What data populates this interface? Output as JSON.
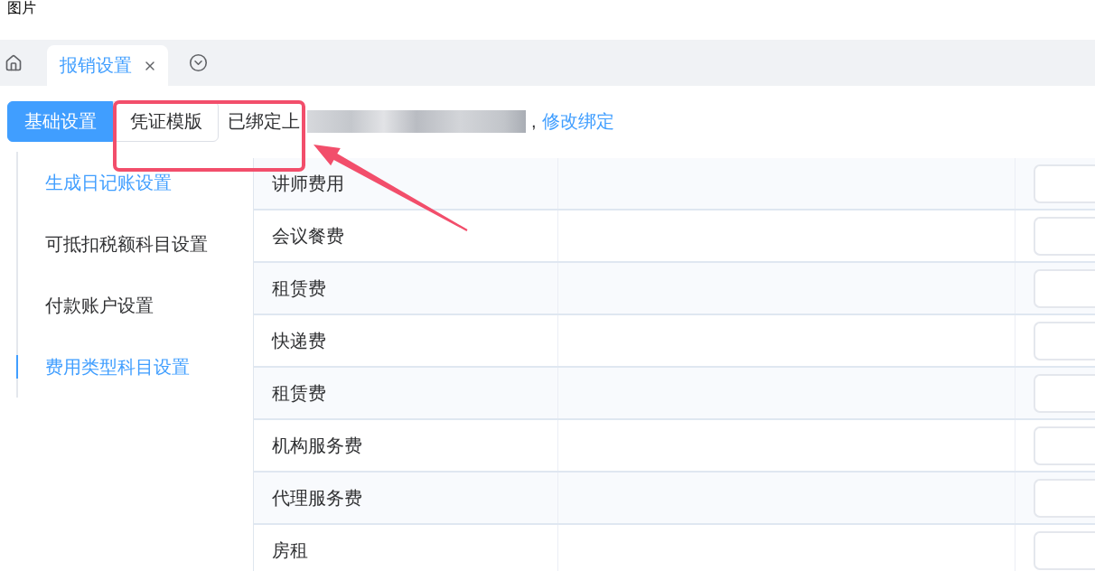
{
  "caption": "图片",
  "tabs": [
    {
      "label": "报销设置",
      "selected": true,
      "closable": true
    }
  ],
  "segments": [
    {
      "label": "基础设置",
      "selected": true
    },
    {
      "label": "凭证模版",
      "selected": false
    }
  ],
  "binding": {
    "status": "已绑定上",
    "separator": ",",
    "link": "修改绑定"
  },
  "menu": [
    {
      "label": "生成日记账设置",
      "selected": false,
      "hovered": true
    },
    {
      "label": "可抵扣税额科目设置",
      "selected": false,
      "hovered": false
    },
    {
      "label": "付款账户设置",
      "selected": false,
      "hovered": false
    },
    {
      "label": "费用类型科目设置",
      "selected": true,
      "hovered": false
    }
  ],
  "table": {
    "rows": [
      {
        "name": "讲师费用"
      },
      {
        "name": "会议餐费"
      },
      {
        "name": "租赁费"
      },
      {
        "name": "快递费"
      },
      {
        "name": "租赁费"
      },
      {
        "name": "机构服务费"
      },
      {
        "name": "代理服务费"
      },
      {
        "name": "房租"
      }
    ]
  }
}
